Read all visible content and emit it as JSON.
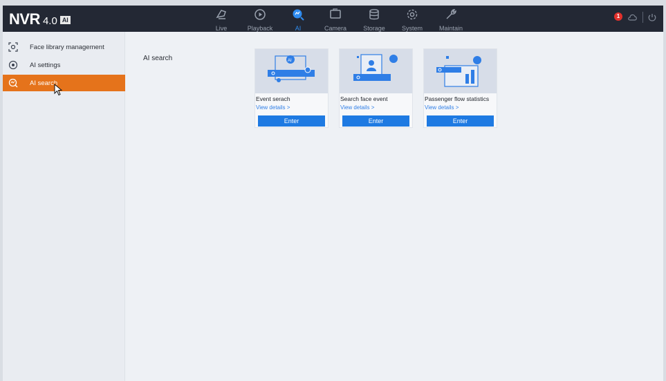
{
  "logo": {
    "brand": "NVR",
    "version": "4.0",
    "badge": "AI"
  },
  "nav": [
    {
      "label": "Live",
      "icon": "live-icon"
    },
    {
      "label": "Playback",
      "icon": "playback-icon"
    },
    {
      "label": "AI",
      "icon": "ai-icon",
      "active": true
    },
    {
      "label": "Camera",
      "icon": "camera-icon"
    },
    {
      "label": "Storage",
      "icon": "storage-icon"
    },
    {
      "label": "System",
      "icon": "gear-icon"
    },
    {
      "label": "Maintain",
      "icon": "wrench-icon"
    }
  ],
  "alerts": {
    "count": "1",
    "icons": [
      "alarm-icon",
      "cloud-icon",
      "power-icon"
    ]
  },
  "sidebar": {
    "items": [
      {
        "label": "Face library management",
        "icon": "face-library-icon"
      },
      {
        "label": "AI settings",
        "icon": "ai-settings-icon"
      },
      {
        "label": "AI search",
        "icon": "ai-search-icon",
        "active": true
      }
    ]
  },
  "main": {
    "breadcrumb": "AI search",
    "cards": [
      {
        "title": "Event serach",
        "link": "View details >",
        "button": "Enter"
      },
      {
        "title": "Search face event",
        "link": "View details >",
        "button": "Enter"
      },
      {
        "title": "Passenger flow statistics",
        "link": "View details >",
        "button": "Enter"
      }
    ]
  },
  "colors": {
    "topbar": "#232834",
    "active_nav": "#2f8cf0",
    "active_side": "#e5731b",
    "button": "#1e7ae2",
    "link": "#2f7ee6"
  }
}
